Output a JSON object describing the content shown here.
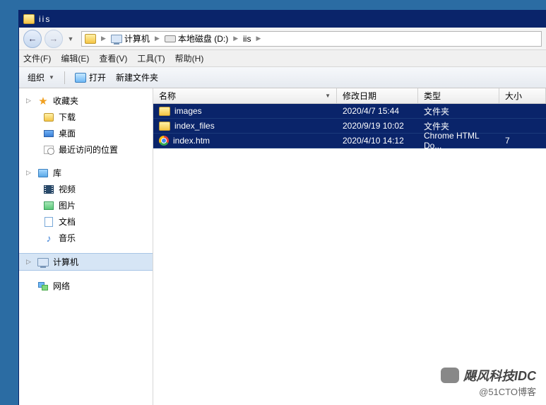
{
  "window": {
    "title": "iis"
  },
  "breadcrumb": {
    "computer": "计算机",
    "drive": "本地磁盘 (D:)",
    "folder": "iis"
  },
  "menu": {
    "file": "文件(F)",
    "edit": "编辑(E)",
    "view": "查看(V)",
    "tools": "工具(T)",
    "help": "帮助(H)"
  },
  "toolbar": {
    "organize": "组织",
    "open": "打开",
    "newfolder": "新建文件夹"
  },
  "sidebar": {
    "favorites": "收藏夹",
    "downloads": "下载",
    "desktop": "桌面",
    "recent": "最近访问的位置",
    "libraries": "库",
    "videos": "视频",
    "pictures": "图片",
    "documents": "文档",
    "music": "音乐",
    "computer": "计算机",
    "network": "网络"
  },
  "columns": {
    "name": "名称",
    "date": "修改日期",
    "type": "类型",
    "size": "大小"
  },
  "files": [
    {
      "name": "images",
      "date": "2020/4/7 15:44",
      "type": "文件夹",
      "size": "",
      "icon": "folder"
    },
    {
      "name": "index_files",
      "date": "2020/9/19 10:02",
      "type": "文件夹",
      "size": "",
      "icon": "folder"
    },
    {
      "name": "index.htm",
      "date": "2020/4/10 14:12",
      "type": "Chrome HTML Do...",
      "size": "7",
      "icon": "chrome"
    }
  ],
  "watermark": {
    "line1": "飓风科技IDC",
    "line2": "@51CTO博客"
  }
}
